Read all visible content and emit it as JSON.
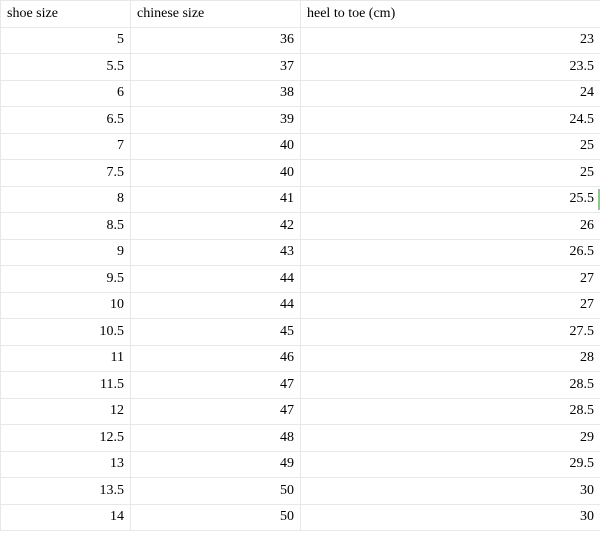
{
  "chart_data": {
    "type": "table",
    "columns": [
      "shoe size",
      "chinese size",
      "heel to toe (cm)"
    ],
    "rows": [
      [
        "5",
        "36",
        "23"
      ],
      [
        "5.5",
        "37",
        "23.5"
      ],
      [
        "6",
        "38",
        "24"
      ],
      [
        "6.5",
        "39",
        "24.5"
      ],
      [
        "7",
        "40",
        "25"
      ],
      [
        "7.5",
        "40",
        "25"
      ],
      [
        "8",
        "41",
        "25.5"
      ],
      [
        "8.5",
        "42",
        "26"
      ],
      [
        "9",
        "43",
        "26.5"
      ],
      [
        "9.5",
        "44",
        "27"
      ],
      [
        "10",
        "44",
        "27"
      ],
      [
        "10.5",
        "45",
        "27.5"
      ],
      [
        "11",
        "46",
        "28"
      ],
      [
        "11.5",
        "47",
        "28.5"
      ],
      [
        "12",
        "47",
        "28.5"
      ],
      [
        "12.5",
        "48",
        "29"
      ],
      [
        "13",
        "49",
        "29.5"
      ],
      [
        "13.5",
        "50",
        "30"
      ],
      [
        "14",
        "50",
        "30"
      ]
    ]
  }
}
